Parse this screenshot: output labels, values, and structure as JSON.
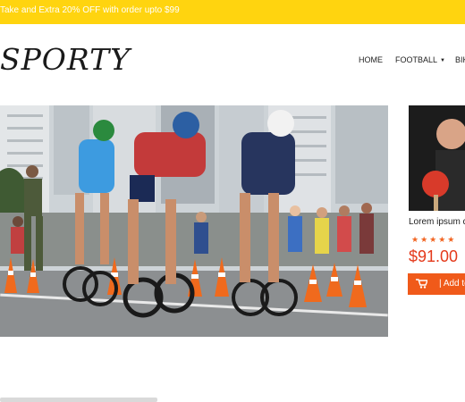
{
  "promo": {
    "text": "Take and Extra 20% OFF with order upto $99"
  },
  "header": {
    "logo": "SPORTY",
    "nav": [
      {
        "label": "HOME"
      },
      {
        "label": "FOOTBALL"
      },
      {
        "label": "BIK"
      }
    ]
  },
  "product": {
    "title": "Lorem ipsum d",
    "stars": "★★★★★",
    "price": "$91.00",
    "button_label": "| Add to"
  },
  "colors": {
    "promo_bg": "#ffd40f",
    "price": "#e4391b",
    "accent": "#f05a1a"
  }
}
